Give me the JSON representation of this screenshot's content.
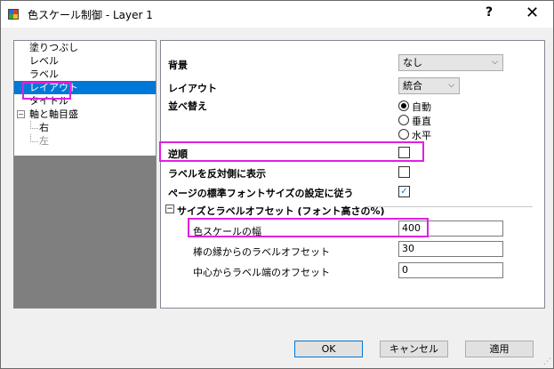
{
  "window": {
    "title": "色スケール制御 - Layer 1",
    "help": "?",
    "close": "✕"
  },
  "tree": {
    "items": [
      {
        "label": "塗りつぶし"
      },
      {
        "label": "レベル"
      },
      {
        "label": "ラベル"
      },
      {
        "label": "レイアウト",
        "selected": true
      },
      {
        "label": "タイトル"
      },
      {
        "label": "軸と軸目盛",
        "expander": "−"
      },
      {
        "label": "右",
        "child": true
      },
      {
        "label": "左",
        "child": true,
        "disabled": true
      }
    ]
  },
  "panel": {
    "background": {
      "label": "背景",
      "value": "なし"
    },
    "layout": {
      "label": "レイアウト",
      "value": "統合"
    },
    "order": {
      "label": "並べ替え",
      "options": [
        "自動",
        "垂直",
        "水平"
      ],
      "selected": "自動"
    },
    "reverse": {
      "label": "逆順",
      "checked": false
    },
    "label_opposite": {
      "label": "ラベルを反対側に表示",
      "checked": false
    },
    "use_page_font": {
      "label": "ページの標準フォントサイズの設定に従う",
      "checked": true,
      "mark": "✓"
    },
    "size_section": {
      "toggle": "−",
      "label": "サイズとラベルオフセット (フォント高さの%)",
      "width": {
        "label": "色スケールの幅",
        "value": "400"
      },
      "bar_edge_offset": {
        "label": "棒の縁からのラベルオフセット",
        "value": "30"
      },
      "center_offset": {
        "label": "中心からラベル端のオフセット",
        "value": "0"
      }
    }
  },
  "buttons": {
    "ok": "OK",
    "cancel": "キャンセル",
    "apply": "適用"
  },
  "colors": {
    "selection": "#0078d7",
    "highlight": "#e020e0"
  }
}
